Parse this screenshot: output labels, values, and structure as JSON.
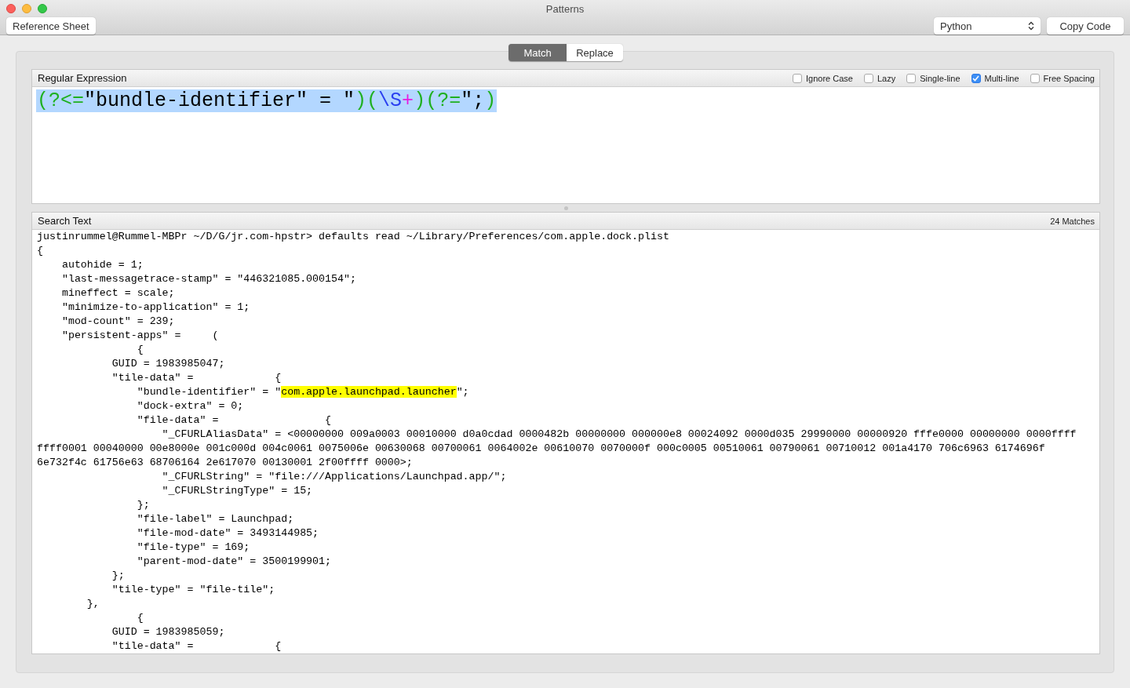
{
  "window": {
    "title": "Patterns"
  },
  "toolbar": {
    "reference_button": "Reference Sheet",
    "language_select": "Python",
    "copy_button": "Copy Code"
  },
  "tabs": [
    {
      "label": "Match",
      "selected": true
    },
    {
      "label": "Replace",
      "selected": false
    }
  ],
  "regex_panel": {
    "title": "Regular Expression",
    "options": [
      {
        "label": "Ignore Case",
        "checked": false
      },
      {
        "label": "Lazy",
        "checked": false
      },
      {
        "label": "Single-line",
        "checked": false
      },
      {
        "label": "Multi-line",
        "checked": true
      },
      {
        "label": "Free Spacing",
        "checked": false
      }
    ],
    "expression": {
      "selected": true,
      "tokens": [
        {
          "text": "(?<=",
          "color": "#1fb01f"
        },
        {
          "text": "\"bundle-identifier\" = \"",
          "color": "#000000"
        },
        {
          "text": ")(",
          "color": "#1fb01f"
        },
        {
          "text": "\\S",
          "color": "#2a3ff0"
        },
        {
          "text": "+",
          "color": "#e81ae0"
        },
        {
          "text": ")(?=",
          "color": "#1fb01f"
        },
        {
          "text": "\";",
          "color": "#000000"
        },
        {
          "text": ")",
          "color": "#1fb01f"
        }
      ]
    }
  },
  "search_panel": {
    "title": "Search Text",
    "match_count": "24 Matches",
    "lines": [
      {
        "text": "justinrummel@Rummel-MBPr ~/D/G/jr.com-hpstr> defaults read ~/Library/Preferences/com.apple.dock.plist"
      },
      {
        "text": "{"
      },
      {
        "text": "    autohide = 1;"
      },
      {
        "text": "    \"last-messagetrace-stamp\" = \"446321085.000154\";"
      },
      {
        "text": "    mineffect = scale;"
      },
      {
        "text": "    \"minimize-to-application\" = 1;"
      },
      {
        "text": "    \"mod-count\" = 239;"
      },
      {
        "text": "    \"persistent-apps\" =     ("
      },
      {
        "text": "                {"
      },
      {
        "text": "            GUID = 1983985047;"
      },
      {
        "text": "            \"tile-data\" =             {"
      },
      {
        "text": "                \"bundle-identifier\" = \"",
        "match": "com.apple.launchpad.launcher",
        "after": "\";"
      },
      {
        "text": "                \"dock-extra\" = 0;"
      },
      {
        "text": "                \"file-data\" =                 {"
      },
      {
        "text": "                    \"_CFURLAliasData\" = <00000000 009a0003 00010000 d0a0cdad 0000482b 00000000 000000e8 00024092 0000d035 29990000 00000920 fffe0000 00000000 0000ffff"
      },
      {
        "text": "ffff0001 00040000 00e8000e 001c000d 004c0061 0075006e 00630068 00700061 0064002e 00610070 0070000f 000c0005 00510061 00790061 00710012 001a4170 706c6963 6174696f"
      },
      {
        "text": "6e732f4c 61756e63 68706164 2e617070 00130001 2f00ffff 0000>;"
      },
      {
        "text": "                    \"_CFURLString\" = \"file:///Applications/Launchpad.app/\";"
      },
      {
        "text": "                    \"_CFURLStringType\" = 15;"
      },
      {
        "text": "                };"
      },
      {
        "text": "                \"file-label\" = Launchpad;"
      },
      {
        "text": "                \"file-mod-date\" = 3493144985;"
      },
      {
        "text": "                \"file-type\" = 169;"
      },
      {
        "text": "                \"parent-mod-date\" = 3500199901;"
      },
      {
        "text": "            };"
      },
      {
        "text": "            \"tile-type\" = \"file-tile\";"
      },
      {
        "text": "        },"
      },
      {
        "text": "                {"
      },
      {
        "text": "            GUID = 1983985059;"
      },
      {
        "text": "            \"tile-data\" =             {"
      }
    ]
  }
}
